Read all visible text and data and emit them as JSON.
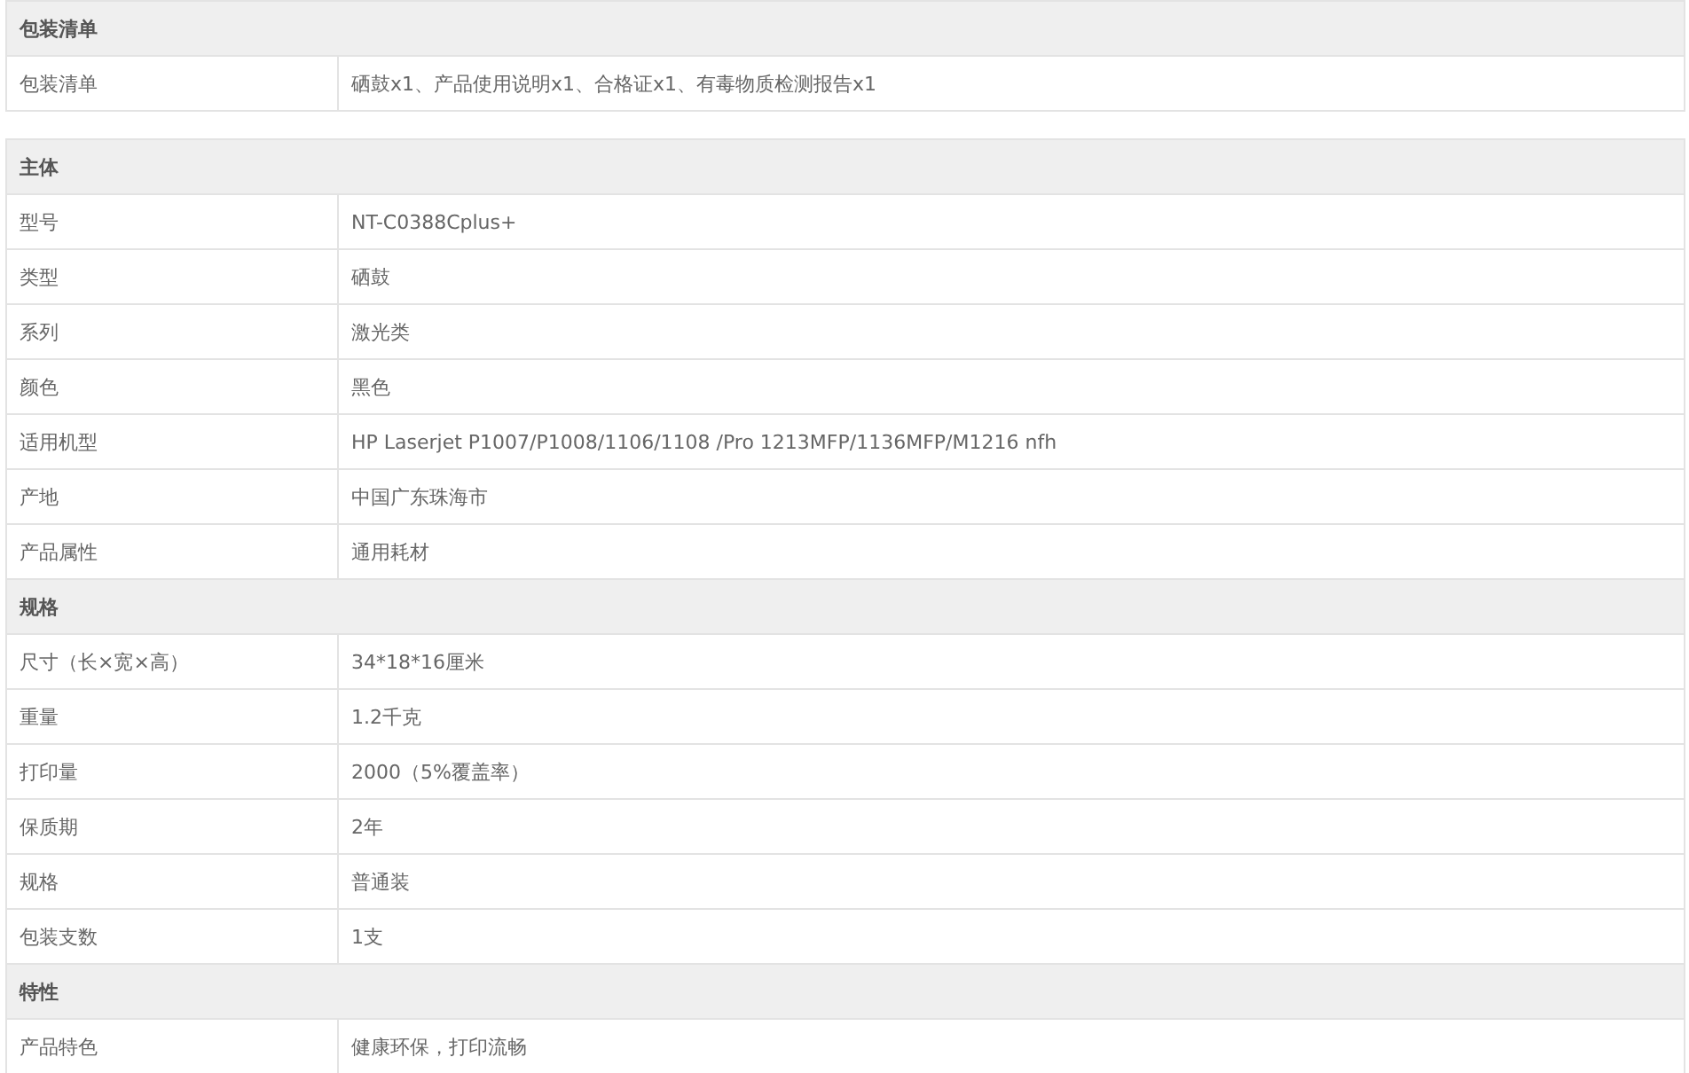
{
  "tables": [
    {
      "sections": [
        {
          "title": "包装清单",
          "rows": [
            {
              "label": "包装清单",
              "value": "硒鼓x1、产品使用说明x1、合格证x1、有毒物质检测报告x1"
            }
          ]
        }
      ]
    },
    {
      "sections": [
        {
          "title": "主体",
          "rows": [
            {
              "label": "型号",
              "value": "NT-C0388Cplus+"
            },
            {
              "label": "类型",
              "value": "硒鼓"
            },
            {
              "label": "系列",
              "value": "激光类"
            },
            {
              "label": "颜色",
              "value": "黑色"
            },
            {
              "label": "适用机型",
              "value": "HP Laserjet P1007/P1008/1106/1108 /Pro 1213MFP/1136MFP/M1216 nfh"
            },
            {
              "label": "产地",
              "value": "中国广东珠海市"
            },
            {
              "label": "产品属性",
              "value": "通用耗材"
            }
          ]
        },
        {
          "title": "规格",
          "rows": [
            {
              "label": "尺寸（长×宽×高）",
              "value": "34*18*16厘米"
            },
            {
              "label": "重量",
              "value": "1.2千克"
            },
            {
              "label": "打印量",
              "value": "2000（5%覆盖率）"
            },
            {
              "label": "保质期",
              "value": "2年"
            },
            {
              "label": "规格",
              "value": "普通装"
            },
            {
              "label": "包装支数",
              "value": "1支"
            }
          ]
        },
        {
          "title": "特性",
          "rows": [
            {
              "label": "产品特色",
              "value": "健康环保，打印流畅"
            }
          ]
        }
      ]
    }
  ]
}
